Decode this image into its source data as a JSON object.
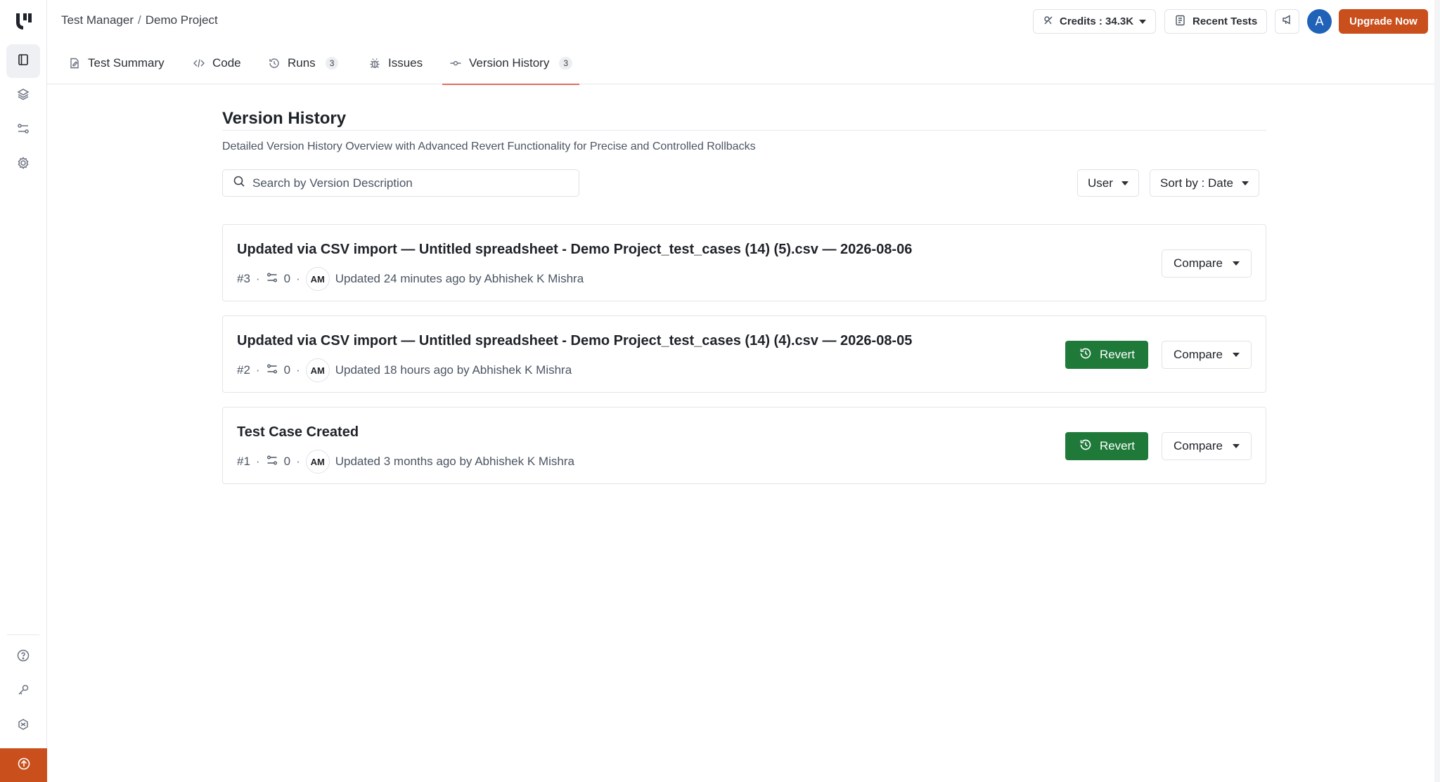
{
  "breadcrumb": {
    "root": "Test Manager",
    "separator": "/",
    "project": "Demo Project"
  },
  "header": {
    "credits_label": "Credits : 34.3K",
    "recent_tests_label": "Recent Tests",
    "avatar_letter": "A",
    "upgrade_label": "Upgrade Now"
  },
  "tabs": [
    {
      "label": "Test Summary",
      "icon": "file-edit-icon"
    },
    {
      "label": "Code",
      "icon": "code-icon"
    },
    {
      "label": "Runs",
      "icon": "history-icon",
      "count": "3"
    },
    {
      "label": "Issues",
      "icon": "bug-icon"
    },
    {
      "label": "Version History",
      "icon": "commit-icon",
      "count": "3",
      "active": true
    }
  ],
  "page": {
    "title": "Version History",
    "subtitle": "Detailed Version History Overview with Advanced Revert Functionality for Precise and Controlled Rollbacks",
    "search_placeholder": "Search by Version Description",
    "user_filter": "User",
    "sort_label": "Sort by : Date"
  },
  "versions": [
    {
      "title": "Updated via CSV import — Untitled spreadsheet - Demo Project_test_cases (14) (5).csv — 2026-08-06",
      "number": "#3",
      "changes": "0",
      "initials": "AM",
      "updated": "Updated 24 minutes ago by Abhishek K Mishra",
      "can_revert": false
    },
    {
      "title": "Updated via CSV import — Untitled spreadsheet - Demo Project_test_cases (14) (4).csv — 2026-08-05",
      "number": "#2",
      "changes": "0",
      "initials": "AM",
      "updated": "Updated 18 hours ago by Abhishek K Mishra",
      "can_revert": true
    },
    {
      "title": "Test Case Created",
      "number": "#1",
      "changes": "0",
      "initials": "AM",
      "updated": "Updated 3 months ago by Abhishek K Mishra",
      "can_revert": true
    }
  ],
  "actions": {
    "revert_label": "Revert",
    "compare_label": "Compare"
  },
  "colors": {
    "accent": "#c94f1c",
    "revert": "#1f7a3a",
    "avatar": "#1f62b8",
    "tab_underline": "#e8695d"
  }
}
